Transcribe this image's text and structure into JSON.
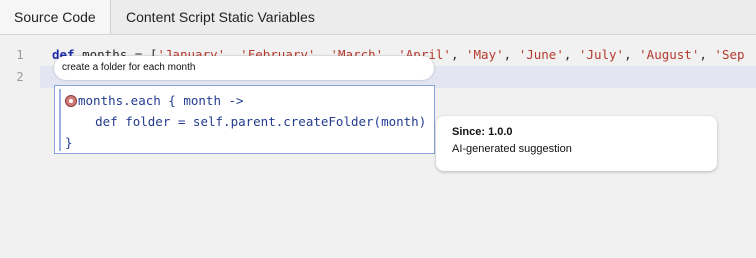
{
  "tabs": [
    {
      "label": "Source Code",
      "active": true
    },
    {
      "label": "Content Script Static Variables",
      "active": false
    }
  ],
  "editor": {
    "line_numbers": [
      "1",
      "2"
    ],
    "line1": {
      "keyword": "def",
      "prefix": " months = [",
      "months": [
        "'January'",
        "'February'",
        "'March'",
        "'April'",
        "'May'",
        "'June'",
        "'July'",
        "'August'",
        "'Sep"
      ],
      "separator": ", "
    }
  },
  "prompt": {
    "text": "create a folder for each month"
  },
  "suggestion": {
    "icon": "ai-suggestion-icon",
    "lines": [
      "months.each { month ->",
      "    def folder = self.parent.createFolder(month)",
      "}"
    ]
  },
  "tooltip": {
    "since": "Since: 1.0.0",
    "description": "AI-generated suggestion"
  }
}
